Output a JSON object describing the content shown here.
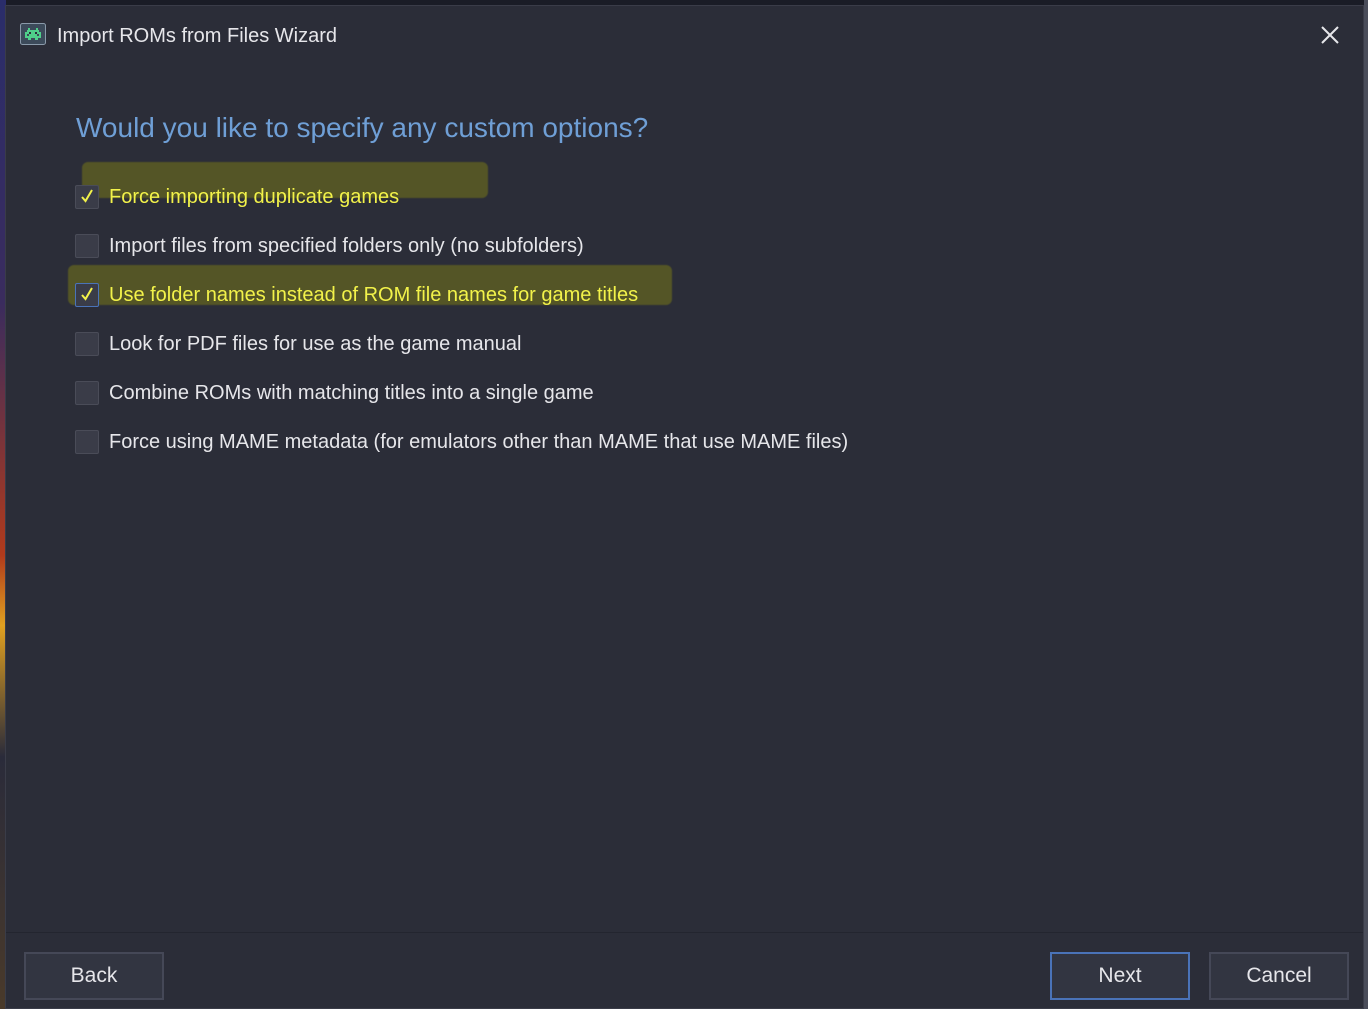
{
  "window": {
    "title": "Import ROMs from Files Wizard"
  },
  "page": {
    "heading": "Would you like to specify any custom options?"
  },
  "options": [
    {
      "label": "Force importing duplicate games",
      "checked": true
    },
    {
      "label": "Import files from specified folders only (no subfolders)",
      "checked": false
    },
    {
      "label": "Use folder names instead of ROM file names for game titles",
      "checked": true
    },
    {
      "label": "Look for PDF files for use as the game manual",
      "checked": false
    },
    {
      "label": "Combine ROMs with matching titles into a single game",
      "checked": false
    },
    {
      "label": "Force using MAME metadata (for emulators other than MAME that use MAME files)",
      "checked": false
    }
  ],
  "footer": {
    "back_label": "Back",
    "next_label": "Next",
    "cancel_label": "Cancel"
  },
  "colors": {
    "heading": "#6f9fd6",
    "checked_label": "#f2f24a",
    "highlight": "#aaaa00",
    "window_bg": "#2b2d38",
    "primary_border": "#4a73b8"
  },
  "icons": {
    "app": "space-invader-icon",
    "close": "close-icon",
    "check": "checkmark-icon"
  }
}
